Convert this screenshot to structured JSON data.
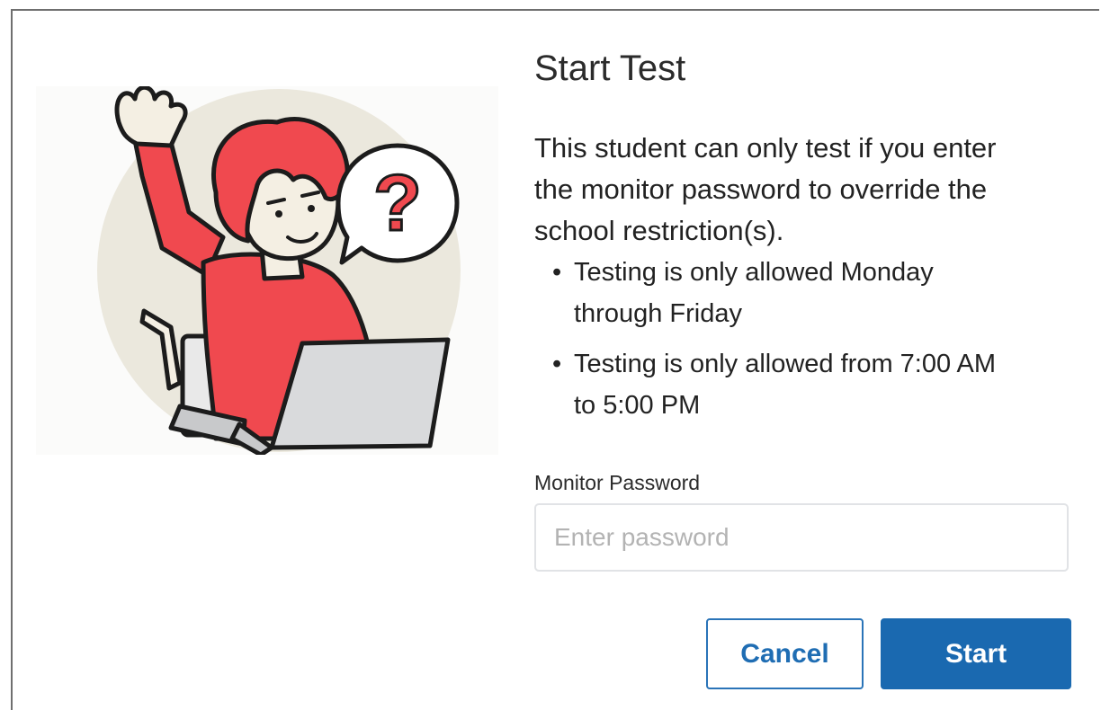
{
  "dialog": {
    "title": "Start Test",
    "message_lines": [
      "This student can only test if you enter",
      "the monitor password to override the",
      "school restriction(s)."
    ],
    "restrictions": [
      {
        "lines": [
          "Testing is only allowed Monday",
          "through Friday"
        ]
      },
      {
        "lines": [
          "Testing is only allowed from 7:00 AM",
          "to 5:00 PM"
        ]
      }
    ],
    "bullet_glyph": "•",
    "password_field": {
      "label": "Monitor Password",
      "placeholder": "Enter password",
      "value": ""
    },
    "buttons": {
      "cancel_label": "Cancel",
      "start_label": "Start"
    }
  },
  "illustration": {
    "name": "student-raising-hand-illustration",
    "bubble_symbol": "?",
    "colors": {
      "backdrop_circle": "#ebe8dd",
      "shirt_and_hair": "#f0494f",
      "skin": "#f4efe3",
      "laptop": "#d9dadc",
      "outline": "#1c1c1c"
    }
  },
  "colors": {
    "primary": "#1a69b0",
    "text": "#222222",
    "input_border": "#e1e3e6",
    "placeholder": "#b3b3b3"
  }
}
